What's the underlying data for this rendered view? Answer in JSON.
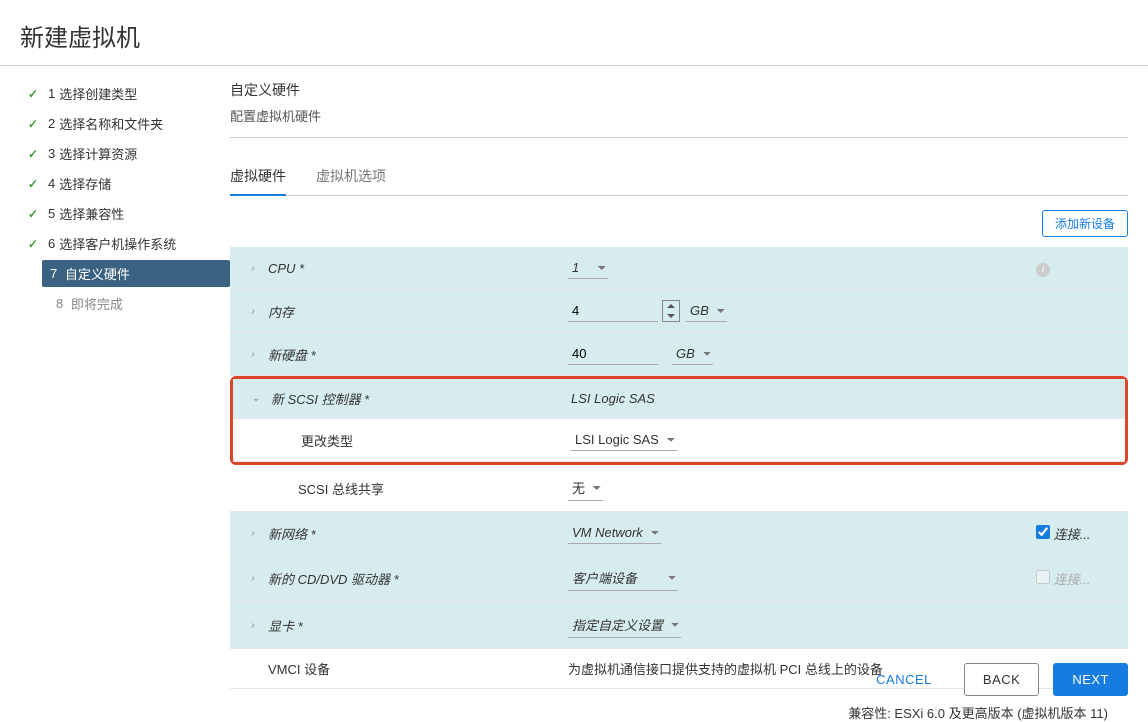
{
  "title": "新建虚拟机",
  "steps": [
    {
      "num": "1",
      "label": "选择创建类型",
      "done": true
    },
    {
      "num": "2",
      "label": "选择名称和文件夹",
      "done": true
    },
    {
      "num": "3",
      "label": "选择计算资源",
      "done": true
    },
    {
      "num": "4",
      "label": "选择存储",
      "done": true
    },
    {
      "num": "5",
      "label": "选择兼容性",
      "done": true
    },
    {
      "num": "6",
      "label": "选择客户机操作系统",
      "done": true
    },
    {
      "num": "7",
      "label": "自定义硬件",
      "active": true
    },
    {
      "num": "8",
      "label": "即将完成",
      "future": true
    }
  ],
  "main": {
    "heading": "自定义硬件",
    "subheading": "配置虚拟机硬件",
    "tabs": {
      "hw": "虚拟硬件",
      "opts": "虚拟机选项"
    },
    "add_device": "添加新设备"
  },
  "hw": {
    "cpu": {
      "label": "CPU *",
      "value": "1"
    },
    "memory": {
      "label": "内存",
      "value": "4",
      "unit": "GB"
    },
    "disk": {
      "label": "新硬盘 *",
      "value": "40",
      "unit": "GB"
    },
    "scsi": {
      "label": "新 SCSI 控制器 *",
      "value": "LSI Logic SAS"
    },
    "scsi_type": {
      "label": "更改类型",
      "value": "LSI Logic SAS"
    },
    "scsi_bus": {
      "label": "SCSI 总线共享",
      "value": "无"
    },
    "network": {
      "label": "新网络 *",
      "value": "VM Network",
      "connect": "连接..."
    },
    "cddvd": {
      "label": "新的 CD/DVD 驱动器 *",
      "value": "客户端设备",
      "connect": "连接..."
    },
    "video": {
      "label": "显卡 *",
      "value": "指定自定义设置"
    },
    "vmci": {
      "label": "VMCI 设备",
      "value": "为虚拟机通信接口提供支持的虚拟机 PCI 总线上的设备"
    }
  },
  "compat": "兼容性: ESXi 6.0 及更高版本 (虚拟机版本 11)",
  "footer": {
    "cancel": "CANCEL",
    "back": "BACK",
    "next": "NEXT"
  }
}
